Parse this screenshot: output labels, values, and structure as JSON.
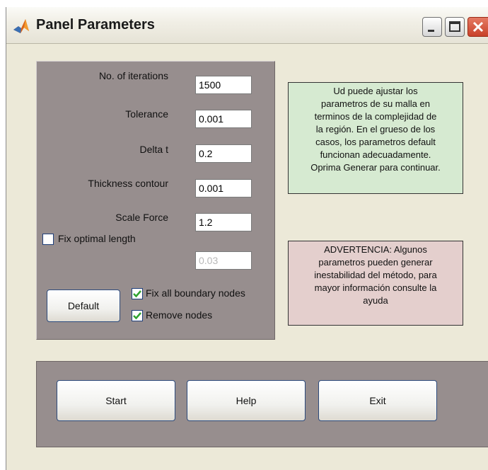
{
  "window": {
    "title": "Panel Parameters"
  },
  "params": {
    "iterations": {
      "label": "No. of iterations",
      "value": "1500"
    },
    "tolerance": {
      "label": "Tolerance",
      "value": "0.001"
    },
    "delta_t": {
      "label": "Delta t",
      "value": "0.2"
    },
    "thickness": {
      "label": "Thickness contour",
      "value": "0.001"
    },
    "scale_force": {
      "label": "Scale Force",
      "value": "1.2"
    },
    "fix_optimal": {
      "label": "Fix optimal length",
      "checked": false,
      "value": "0.03"
    },
    "default_label": "Default",
    "fix_boundary": {
      "label": "Fix all boundary nodes",
      "checked": true
    },
    "remove_nodes": {
      "label": "Remove nodes",
      "checked": true
    }
  },
  "info": {
    "lines": [
      "Ud puede ajustar los",
      "parametros de su malla en",
      "terminos de la complejidad de",
      "la región. En el grueso de los",
      "casos, los parametros default",
      "funcionan adecuadamente.",
      "Oprima Generar para continuar."
    ]
  },
  "warning": {
    "lines": [
      "ADVERTENCIA: Algunos",
      "parametros pueden generar",
      "inestabilidad del método, para",
      "mayor información consulte la",
      "ayuda"
    ]
  },
  "actions": {
    "start_label": "Start",
    "help_label": "Help",
    "exit_label": "Exit"
  },
  "colors": {
    "panel": "#978e8e",
    "info_bg": "#d6ead1",
    "warning_bg": "#e4cfcd",
    "check": "#2fa32f"
  }
}
